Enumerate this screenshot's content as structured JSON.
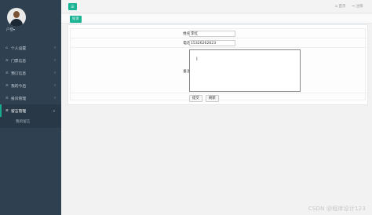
{
  "sidebar": {
    "user_name": "户登",
    "user_caret": "▾",
    "items": [
      {
        "label": "个人设置",
        "icon": "home-icon",
        "glyph": "⌂",
        "arrow": "‹"
      },
      {
        "label": "门票信息",
        "icon": "list-icon",
        "glyph": "≡",
        "arrow": "‹"
      },
      {
        "label": "预订信息",
        "icon": "list-icon",
        "glyph": "≡",
        "arrow": "‹"
      },
      {
        "label": "我的今后",
        "icon": "list-icon",
        "glyph": "≡",
        "arrow": "‹"
      },
      {
        "label": "投诉管理",
        "icon": "list-icon",
        "glyph": "≡",
        "arrow": "‹"
      },
      {
        "label": "留言管理",
        "icon": "list-icon",
        "glyph": "≡",
        "arrow": "⌄"
      }
    ],
    "sub_items": [
      {
        "label": "我的留言"
      }
    ]
  },
  "topbar": {
    "menu_glyph": "☰",
    "home_label": "⌂ 首页",
    "logout_label": "⇥ 注销"
  },
  "tabs": {
    "active_label": "投诉"
  },
  "form": {
    "name_label": "姓名:",
    "name_value": "李红",
    "phone_label": "电话:",
    "phone_value": "15326262623",
    "remark_label": "备注:",
    "remark_value": "",
    "submit_label": "提交",
    "reset_label": "刷新"
  },
  "watermark": "CSDN @程序设计123",
  "colors": {
    "sidebar_bg": "#2f4050",
    "accent": "#1ab394",
    "panel_bg": "#ffffff"
  }
}
